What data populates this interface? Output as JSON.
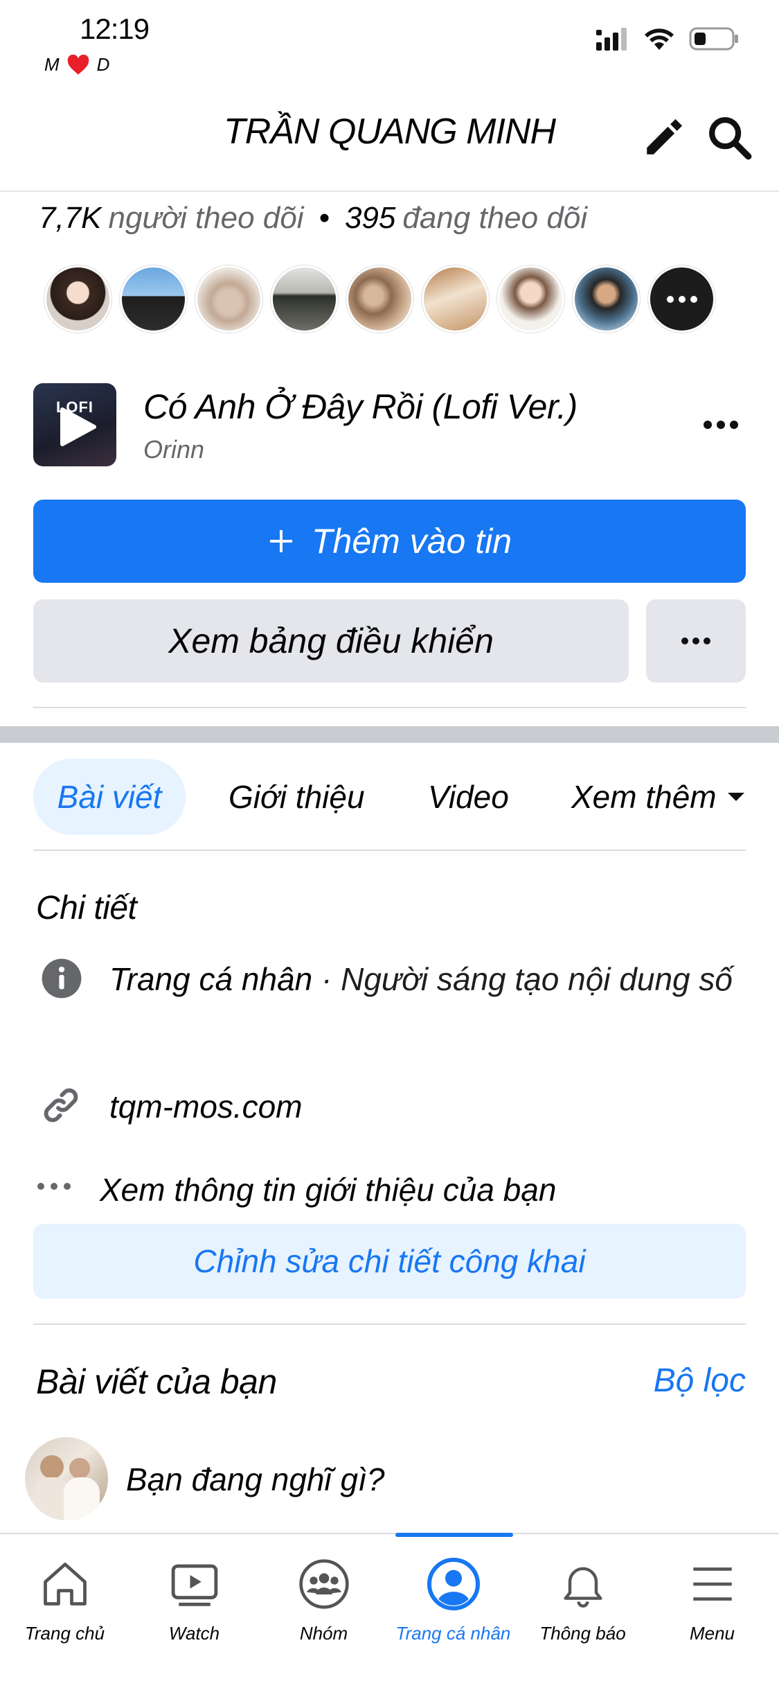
{
  "status_bar": {
    "time": "12:19",
    "sub_left": "M",
    "sub_right": "D"
  },
  "header": {
    "title": "TRẦN QUANG MINH",
    "edit_icon": "pencil-icon",
    "search_icon": "search-icon"
  },
  "follow": {
    "followers_count": "7,7K",
    "followers_label": "người theo dõi",
    "separator": "•",
    "following_count": "395",
    "following_label": "đang theo dõi"
  },
  "music": {
    "thumb_text": "LOFI",
    "title": "Có Anh Ở Đây Rồi (Lofi Ver.)",
    "artist": "Orinn"
  },
  "buttons": {
    "add_story": "Thêm vào tin",
    "dashboard": "Xem bảng điều khiển"
  },
  "tabs": [
    {
      "label": "Bài viết"
    },
    {
      "label": "Giới thiệu"
    },
    {
      "label": "Video"
    },
    {
      "label": "Xem thêm"
    }
  ],
  "details": {
    "title": "Chi tiết",
    "profile_type_bold": "Trang cá nhân",
    "profile_type_rest": " · Người sáng tạo nội dung số",
    "website": "tqm-mos.com",
    "see_about": "Xem thông tin giới thiệu của bạn",
    "edit_public": "Chỉnh sửa chi tiết công khai"
  },
  "posts": {
    "title": "Bài viết của bạn",
    "filter": "Bộ lọc",
    "prompt": "Bạn đang nghĩ gì?"
  },
  "nav": [
    {
      "label": "Trang chủ",
      "icon": "home-icon"
    },
    {
      "label": "Watch",
      "icon": "watch-icon"
    },
    {
      "label": "Nhóm",
      "icon": "groups-icon"
    },
    {
      "label": "Trang cá nhân",
      "icon": "profile-icon",
      "active": true
    },
    {
      "label": "Thông báo",
      "icon": "bell-icon"
    },
    {
      "label": "Menu",
      "icon": "menu-icon"
    }
  ],
  "colors": {
    "primary": "#1877f2",
    "button_gray": "#e4e6eb",
    "light_blue": "#e7f3ff",
    "secondary_text": "#65676b"
  }
}
